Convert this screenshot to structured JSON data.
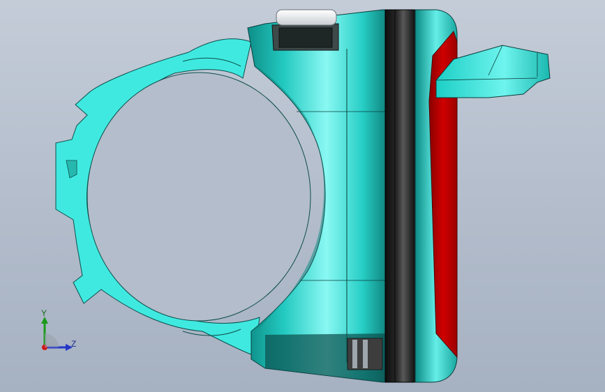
{
  "viewport": {
    "background_top": "#c4ccd8",
    "background_bottom": "#a6b1c2"
  },
  "model": {
    "body_color": "#1fcfc4",
    "body_highlight": "#7ef7f2",
    "body_shadow": "#0a7c78",
    "clamp_color": "#3fe9e0",
    "lens_color": "#c80000",
    "band_color": "#1b1b1b",
    "button_color": "#f2f4f6"
  },
  "triad": {
    "y_label": "Y",
    "z_label": "Z",
    "y_color": "#1a9a1a",
    "z_color": "#2436c8",
    "x_color": "#d01818"
  }
}
